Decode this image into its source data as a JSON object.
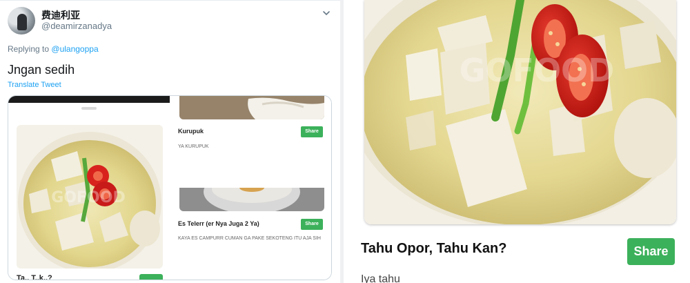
{
  "tweet": {
    "display_name": "费迪利亚",
    "handle": "@deamirzanadya",
    "replying_prefix": "Replying to",
    "replying_handle": "@ulangoppa",
    "text": "Jngan sedih",
    "translate_label": "Translate Tweet"
  },
  "media": {
    "left_title": "Ta.. T..k..?",
    "items": [
      {
        "name": "Kurupuk",
        "description": "YA KURUPUK",
        "share_label": "Share"
      },
      {
        "name": "Es Telerr (er Nya Juga 2 Ya)",
        "description": "KAYA ES CAMPURR CUMAN GA PAKE SEKOTENG ITU AJA SIH",
        "share_label": "Share"
      }
    ],
    "watermark": "GOFOOD"
  },
  "detail": {
    "title": "Tahu Opor, Tahu Kan?",
    "share_label": "Share",
    "description": "Iya tahu",
    "watermark": "GOFOOD"
  },
  "colors": {
    "share_green": "#3cb15b",
    "twitter_blue": "#1da1f2",
    "muted_gray": "#657786"
  },
  "icons": {
    "chevron": "chevron-down-icon"
  }
}
